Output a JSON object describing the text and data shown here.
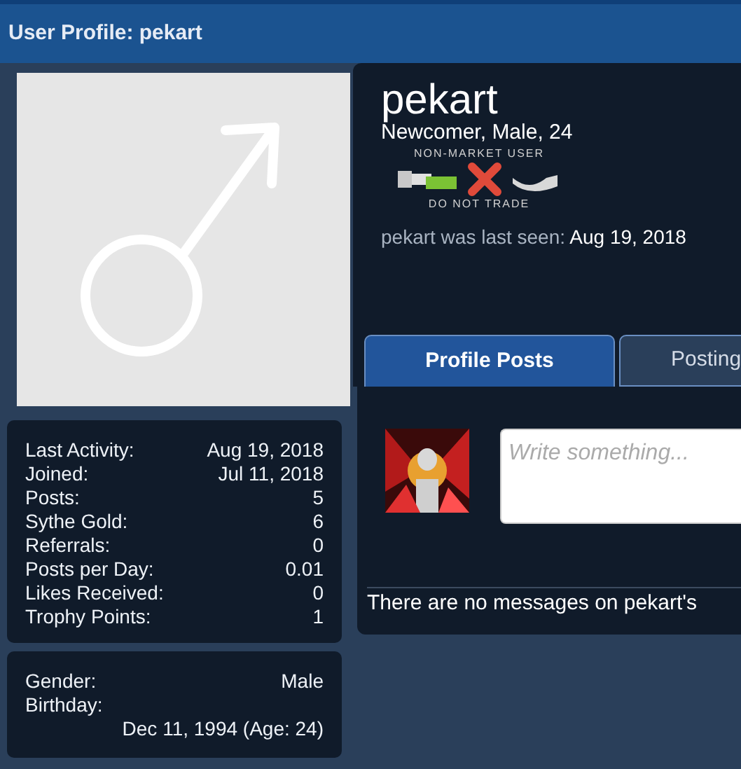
{
  "page_title": "User Profile: pekart",
  "profile": {
    "username": "pekart",
    "subtitle": "Newcomer, Male, 24",
    "badge": {
      "top": "NON-MARKET USER",
      "bottom": "DO NOT TRADE"
    },
    "last_seen_label": "pekart was last seen:",
    "last_seen_value": "Aug 19, 2018"
  },
  "stats": [
    {
      "label": "Last Activity:",
      "value": "Aug 19, 2018"
    },
    {
      "label": "Joined:",
      "value": "Jul 11, 2018"
    },
    {
      "label": "Posts:",
      "value": "5"
    },
    {
      "label": "Sythe Gold:",
      "value": "6"
    },
    {
      "label": "Referrals:",
      "value": "0"
    },
    {
      "label": "Posts per Day:",
      "value": "0.01"
    },
    {
      "label": "Likes Received:",
      "value": "0"
    },
    {
      "label": "Trophy Points:",
      "value": "1"
    }
  ],
  "info": {
    "gender_label": "Gender:",
    "gender_value": "Male",
    "birthday_label": "Birthday:",
    "birthday_value": "Dec 11, 1994 (Age: 24)"
  },
  "tabs": [
    {
      "label": "Profile Posts",
      "selected": true
    },
    {
      "label": "Posting",
      "selected": false
    }
  ],
  "post_box": {
    "placeholder": "Write something..."
  },
  "empty_message": "There are no messages on pekart's"
}
